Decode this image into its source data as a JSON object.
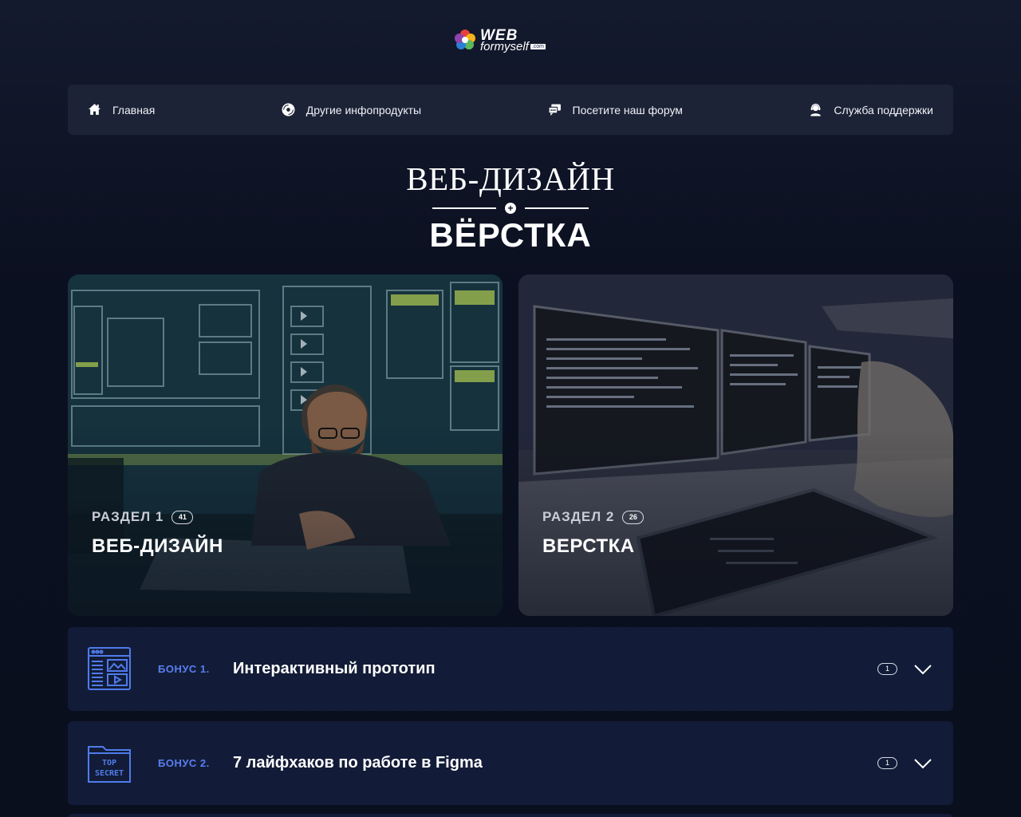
{
  "logo": {
    "web": "WEB",
    "formyself": "formyself",
    "com": ".com"
  },
  "nav": [
    {
      "label": "Главная",
      "icon": "home-icon"
    },
    {
      "label": "Другие инфопродукты",
      "icon": "disc-icon"
    },
    {
      "label": "Посетите наш форум",
      "icon": "chat-icon"
    },
    {
      "label": "Служба поддержки",
      "icon": "support-icon"
    }
  ],
  "title": {
    "line1": "ВЕБ-ДИЗАЙН",
    "plus": "+",
    "line2": "ВЁРСТКА"
  },
  "sections": [
    {
      "label": "РАЗДЕЛ 1",
      "count": "41",
      "title": "ВЕБ-ДИЗАЙН"
    },
    {
      "label": "РАЗДЕЛ 2",
      "count": "26",
      "title": "ВЕРСТКА"
    }
  ],
  "bonuses": [
    {
      "label": "БОНУС 1.",
      "title": "Интерактивный прототип",
      "count": "1",
      "icon": "prototype-icon"
    },
    {
      "label": "БОНУС 2.",
      "title": "7 лайфхаков по работе в Figma",
      "count": "1",
      "icon": "top-secret-folder-icon",
      "icon_text": [
        "TOP",
        "SECRET"
      ]
    }
  ],
  "colors": {
    "accent": "#5a7ef0",
    "nav_bg": "#1d2336",
    "bonus_bg": "#121c38",
    "page_bg": "#0b1020"
  }
}
